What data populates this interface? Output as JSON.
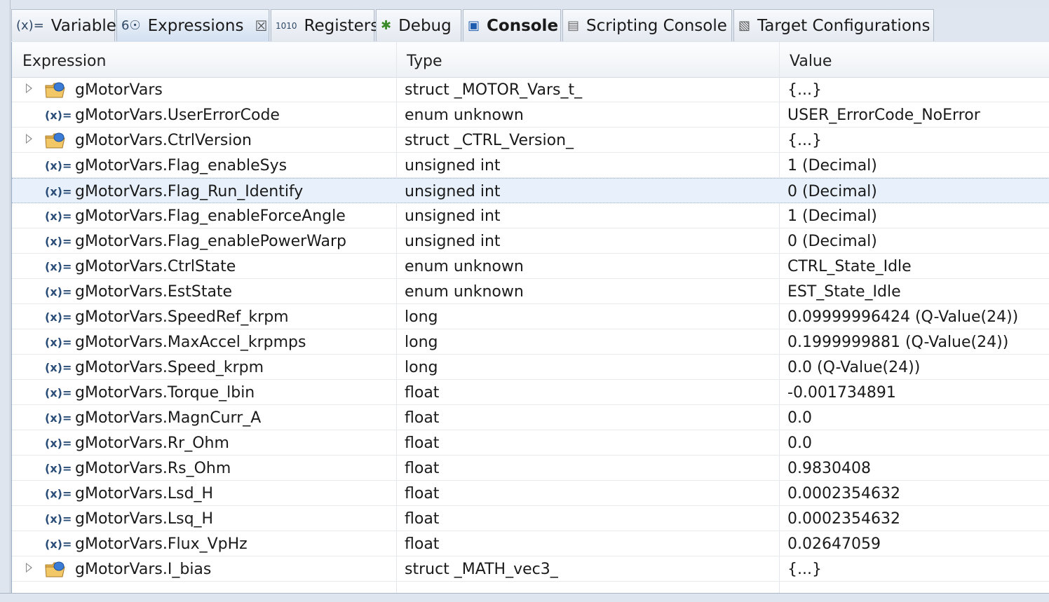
{
  "tabs": [
    {
      "label": "Variables",
      "icon": "variables-icon",
      "glyph": "(x)="
    },
    {
      "label": "Expressions",
      "icon": "expressions-icon",
      "glyph": "6☉",
      "active": true,
      "close": "☒"
    },
    {
      "label": "Registers",
      "icon": "registers-icon",
      "glyph": "1010"
    },
    {
      "label": "Debug",
      "icon": "debug-bug-icon",
      "glyph": "✱"
    },
    {
      "label": "Console",
      "icon": "console-monitor-icon",
      "glyph": "▣"
    },
    {
      "label": "Scripting Console",
      "icon": "scripting-console-icon",
      "glyph": "▤"
    },
    {
      "label": "Target Configurations",
      "icon": "target-config-icon",
      "glyph": "▧"
    }
  ],
  "columns": {
    "expression": "Expression",
    "type": "Type",
    "value": "Value"
  },
  "var_glyph": "(x)=",
  "rows": [
    {
      "name": "gMotorVars",
      "type": "struct _MOTOR_Vars_t_",
      "value": "{...}",
      "expandable": true
    },
    {
      "name": "gMotorVars.UserErrorCode",
      "type": "enum unknown",
      "value": "USER_ErrorCode_NoError"
    },
    {
      "name": "gMotorVars.CtrlVersion",
      "type": "struct _CTRL_Version_",
      "value": "{...}",
      "expandable": true
    },
    {
      "name": "gMotorVars.Flag_enableSys",
      "type": "unsigned int",
      "value": "1 (Decimal)"
    },
    {
      "name": "gMotorVars.Flag_Run_Identify",
      "type": "unsigned int",
      "value": "0 (Decimal)",
      "selected": true
    },
    {
      "name": "gMotorVars.Flag_enableForceAngle",
      "type": "unsigned int",
      "value": "1 (Decimal)"
    },
    {
      "name": "gMotorVars.Flag_enablePowerWarp",
      "type": "unsigned int",
      "value": "0 (Decimal)"
    },
    {
      "name": "gMotorVars.CtrlState",
      "type": "enum unknown",
      "value": "CTRL_State_Idle"
    },
    {
      "name": "gMotorVars.EstState",
      "type": "enum unknown",
      "value": "EST_State_Idle"
    },
    {
      "name": "gMotorVars.SpeedRef_krpm",
      "type": "long",
      "value": "0.09999996424 (Q-Value(24))"
    },
    {
      "name": "gMotorVars.MaxAccel_krpmps",
      "type": "long",
      "value": "0.1999999881 (Q-Value(24))"
    },
    {
      "name": "gMotorVars.Speed_krpm",
      "type": "long",
      "value": "0.0 (Q-Value(24))"
    },
    {
      "name": "gMotorVars.Torque_lbin",
      "type": "float",
      "value": "-0.001734891"
    },
    {
      "name": "gMotorVars.MagnCurr_A",
      "type": "float",
      "value": "0.0"
    },
    {
      "name": "gMotorVars.Rr_Ohm",
      "type": "float",
      "value": "0.0"
    },
    {
      "name": "gMotorVars.Rs_Ohm",
      "type": "float",
      "value": "0.9830408"
    },
    {
      "name": "gMotorVars.Lsd_H",
      "type": "float",
      "value": "0.0002354632"
    },
    {
      "name": "gMotorVars.Lsq_H",
      "type": "float",
      "value": "0.0002354632"
    },
    {
      "name": "gMotorVars.Flux_VpHz",
      "type": "float",
      "value": "0.02647059"
    },
    {
      "name": "gMotorVars.I_bias",
      "type": "struct _MATH_vec3_",
      "value": "{...}",
      "expandable": true
    }
  ],
  "colors": {
    "selection": "#e8f1fb",
    "tab_active": "#d3e0f1",
    "border": "#8fa3bc"
  }
}
